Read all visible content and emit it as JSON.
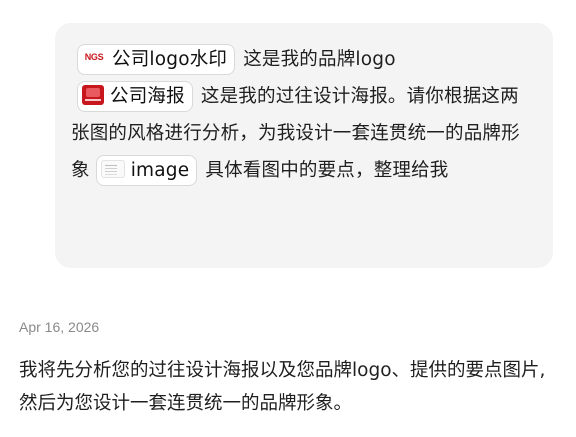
{
  "user_message": {
    "chip_logo": {
      "icon": "ngs-logo-thumbnail",
      "thumb_text": "NGS",
      "label": "公司logo水印"
    },
    "text_after_logo": " 这是我的品牌logo",
    "chip_poster": {
      "icon": "poster-thumbnail",
      "label": "公司海报"
    },
    "text_after_poster": " 这是我的过往设计海报。请你根据这两张图的风格进行分析，为我设计一套连贯统一的品牌形象",
    "chip_image": {
      "icon": "image-thumbnail",
      "label": "image"
    },
    "text_after_image": " 具体看图中的要点，整理给我"
  },
  "assistant": {
    "date": "Apr 16, 2026",
    "reply": "我将先分析您的过往设计海报以及您品牌logo、提供的要点图片,然后为您设计一套连贯统一的品牌形象。"
  },
  "colors": {
    "bubble_bg": "#f4f4f4",
    "chip_border": "#d9d9d9",
    "brand_red": "#c8161d",
    "date_gray": "#8a8a8a"
  }
}
